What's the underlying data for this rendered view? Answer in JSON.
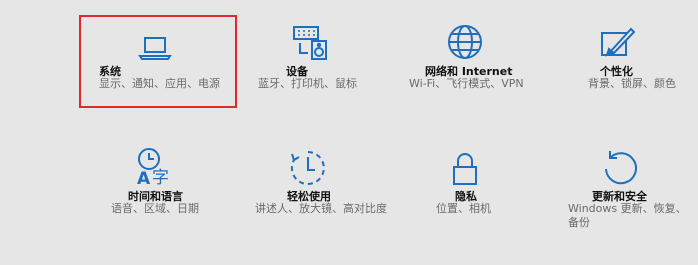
{
  "settings": {
    "tiles": [
      {
        "title": "系统",
        "desc": "显示、通知、应用、电源",
        "icon": "laptop-icon"
      },
      {
        "title": "设备",
        "desc": "蓝牙、打印机、鼠标",
        "icon": "keyboard-speaker-icon"
      },
      {
        "title": "网络和 Internet",
        "desc": "Wi-Fi、飞行模式、VPN",
        "icon": "globe-icon"
      },
      {
        "title": "个性化",
        "desc": "背景、锁屏、颜色",
        "icon": "paint-brush-icon"
      },
      {
        "title": "时间和语言",
        "desc": "语音、区域、日期",
        "icon": "clock-language-icon"
      },
      {
        "title": "轻松使用",
        "desc": "讲述人、放大镜、高对比度",
        "icon": "ease-of-access-icon"
      },
      {
        "title": "隐私",
        "desc": "位置、相机",
        "icon": "lock-icon"
      },
      {
        "title": "更新和安全",
        "desc": "Windows 更新、恢复、备份",
        "icon": "update-icon"
      }
    ]
  },
  "colors": {
    "accent": "#1f6fbf",
    "background": "#e6e6e6",
    "highlight": "#e0282d"
  }
}
